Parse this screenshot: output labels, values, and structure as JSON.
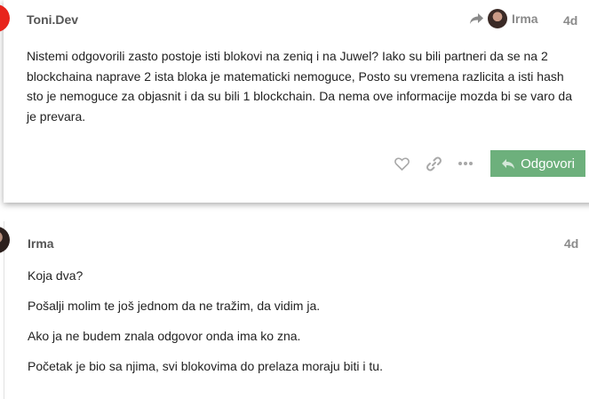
{
  "posts": [
    {
      "username": "Toni.Dev",
      "reply_to_user": "Irma",
      "date": "4d",
      "paragraphs": [
        "Nistemi odgovorili zasto postoje isti blokovi na zeniq i na Juwel? Iako su bili partneri da se na 2 blockchaina naprave 2 ista bloka je matematicki nemoguce, Posto su vremena razlicita a isti hash sto je nemoguce za objasnit i da su bili 1 blockchain. Da nema ove informacije mozda bi se varo da je prevara."
      ],
      "actions": {
        "like_icon": "heart-icon",
        "share_icon": "link-icon",
        "more_icon": "ellipsis-icon",
        "reply_label": "Odgovori"
      }
    },
    {
      "username": "Irma",
      "date": "4d",
      "paragraphs": [
        "Koja dva?",
        "Pošalji molim te još jednom da ne tražim, da vidim ja.",
        "Ako ja ne budem znala odgovor onda ima ko zna.",
        "Početak je bio sa njima, svi blokovima do prelaza moraju biti i tu."
      ]
    }
  ],
  "colors": {
    "reply_button": "#6db07c",
    "meta_text": "#8a8a8a",
    "avatar_toni": "#e8241c"
  }
}
